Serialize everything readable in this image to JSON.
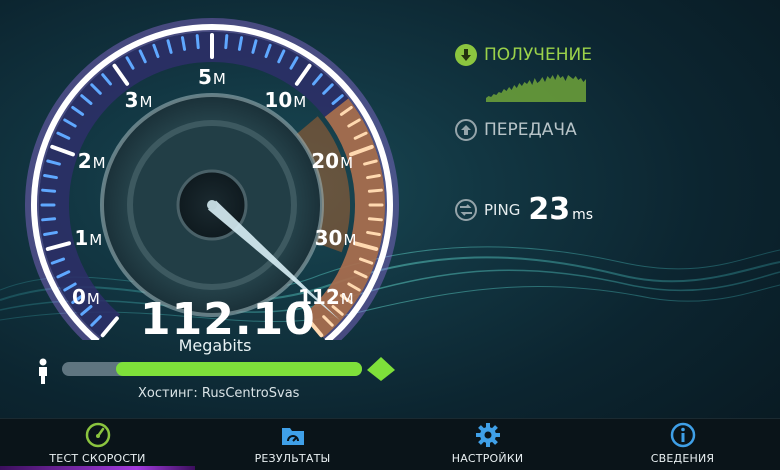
{
  "gauge": {
    "labels": [
      {
        "num": "0",
        "unit": "M"
      },
      {
        "num": "1",
        "unit": "M"
      },
      {
        "num": "2",
        "unit": "M"
      },
      {
        "num": "3",
        "unit": "M"
      },
      {
        "num": "5",
        "unit": "M"
      },
      {
        "num": "10",
        "unit": "M"
      },
      {
        "num": "20",
        "unit": "M"
      },
      {
        "num": "30",
        "unit": "M"
      },
      {
        "num": "112",
        "unit": "M"
      }
    ],
    "colors": {
      "outer_arc": "#ffffff",
      "tick_glow": "#5fa8ff",
      "ring_glow": "#b07bff",
      "hot_zone": "#ff9a3c"
    }
  },
  "result": {
    "value": "112.10",
    "unit": "Megabits",
    "progress_fraction": 0.82,
    "host": "Хостинг: RusCentroSvas"
  },
  "side": {
    "download_label": "ПОЛУЧЕНИЕ",
    "upload_label": "ПЕРЕДАЧА",
    "ping_label": "PING",
    "ping_value": "23",
    "ping_unit": "ms",
    "icons": {
      "download": "arrow-down-icon",
      "upload": "arrow-up-icon",
      "ping": "ping-arrows-icon"
    }
  },
  "tabs": [
    {
      "label": "ТЕСТ СКОРОСТИ",
      "icon": "speedometer-icon",
      "active": true
    },
    {
      "label": "РЕЗУЛЬТАТЫ",
      "icon": "results-folder-icon",
      "active": false
    },
    {
      "label": "НАСТРОЙКИ",
      "icon": "gear-icon",
      "active": false
    },
    {
      "label": "СВЕДЕНИЯ",
      "icon": "info-icon",
      "active": false
    }
  ],
  "colors": {
    "accent_green": "#8bc53f",
    "progress_track": "#5f7580",
    "tab_bar": "#0a1419",
    "active_tab": "#a43be0"
  }
}
